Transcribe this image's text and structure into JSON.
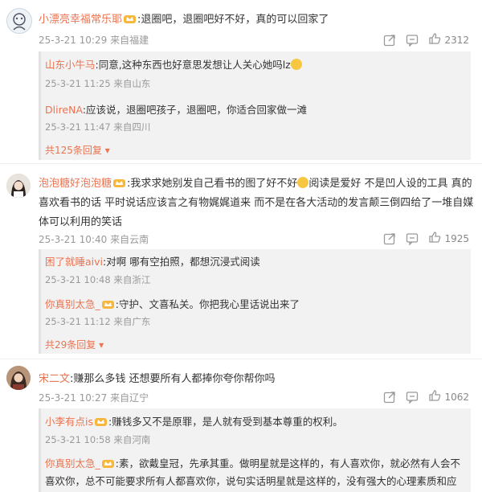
{
  "comments": [
    {
      "user": "小漂亮幸福常乐耶",
      "text": ":退圈吧，退圈吧好不好，真的可以回家了",
      "date": "25-3-21 10:29",
      "location": "来自福建",
      "likes": "2312",
      "replies": [
        {
          "user": "山东小牛马",
          "text": ":同意,这种东西也好意思发想让人关心她吗lz",
          "date": "25-3-21 11:25",
          "location": "来自山东"
        },
        {
          "user": "DlireNA",
          "text": ":应该说，退圈吧孩子，退圈吧，你适合回家做一滩",
          "date": "25-3-21 11:47",
          "location": "来自四川"
        }
      ],
      "more": "共125条回复"
    },
    {
      "user": "泡泡糖好泡泡糖",
      "text_line1": ":我求求她别发自己看书的图了好不好",
      "text_line1b": "阅读是爱好 不是凹人设的工具 真的",
      "text_line2": "喜欢看书的话 平时说话应该言之有物娓娓道来 而不是在各大活动的发言颠三倒四给了一堆自媒",
      "text_line3": "体可以利用的笑话",
      "date": "25-3-21 10:40",
      "location": "来自云南",
      "likes": "1925",
      "replies": [
        {
          "user": "困了就睡aivi",
          "text": ":对啊 哪有空拍照，都想沉浸式阅读",
          "date": "25-3-21 10:48",
          "location": "来自浙江"
        },
        {
          "user": "你真别太急_",
          "text": ":守护、文喜私关。你把我心里话说出来了",
          "date": "25-3-21 11:12",
          "location": "来自广东"
        }
      ],
      "more": "共29条回复"
    },
    {
      "user": "宋二文",
      "text": ":赚那么多钱 还想要所有人都捧你夸你帮你吗",
      "date": "25-3-21 10:27",
      "location": "来自辽宁",
      "likes": "1062",
      "replies": [
        {
          "user": "小李有点is",
          "text": ":赚钱多又不是原罪，是人就有受到基本尊重的权利。",
          "date": "25-3-21 10:58",
          "location": "来自河南"
        },
        {
          "user": "你真别太急_",
          "text_line1": ":素，欲戴皇冠，先承其重。做明星就是这样的，有人喜欢你，就必然有人会不",
          "text_line2": "喜欢你，总不可能要求所有人都喜欢你，说句实话明星就是这样的，没有强大的心理素质和应"
        }
      ]
    }
  ],
  "colors": {
    "username": "#eb7350",
    "meta": "#999999",
    "reply_bg": "#f2f2f2"
  }
}
